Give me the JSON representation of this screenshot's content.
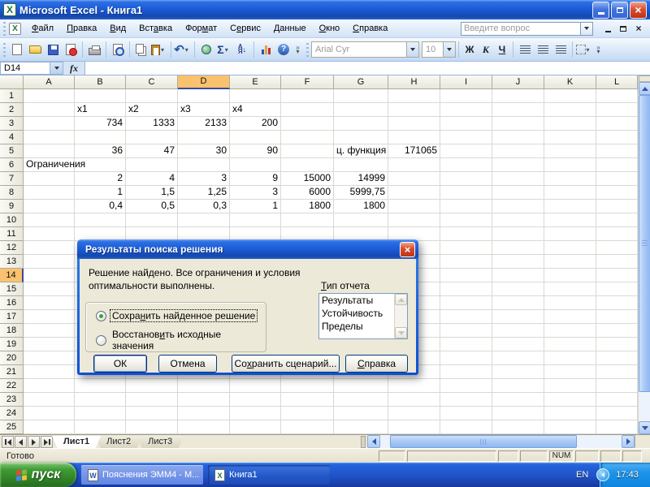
{
  "window": {
    "title": "Microsoft Excel - Книга1"
  },
  "icons": {
    "excel_letter": "X",
    "word_letter": "W",
    "close": "×",
    "dropdown": "▾",
    "chevron": "»",
    "sigma": "Σ",
    "undo": "↶",
    "help": "?",
    "sort_a": "А",
    "sort_z": "Я",
    "sort_arrow": "↓",
    "fx": "fx"
  },
  "menu": {
    "question_placeholder": "Введите вопрос",
    "items": [
      {
        "name": "file",
        "label": "Файл",
        "u": 0
      },
      {
        "name": "edit",
        "label": "Правка",
        "u": 0
      },
      {
        "name": "view",
        "label": "Вид",
        "u": 0
      },
      {
        "name": "insert",
        "label": "Вставка",
        "u": 3
      },
      {
        "name": "format",
        "label": "Формат",
        "u": 3
      },
      {
        "name": "tools",
        "label": "Сервис",
        "u": 1
      },
      {
        "name": "data",
        "label": "Данные",
        "u": 0
      },
      {
        "name": "window",
        "label": "Окно",
        "u": 0
      },
      {
        "name": "help",
        "label": "Справка",
        "u": 0
      }
    ]
  },
  "toolbar": {
    "font_name": "Arial Cyr",
    "font_size": "10",
    "bold": "Ж",
    "italic": "К",
    "underline": "Ч"
  },
  "formula_bar": {
    "name_box": "D14"
  },
  "sheet": {
    "columns": [
      "A",
      "B",
      "C",
      "D",
      "E",
      "F",
      "G",
      "H",
      "I",
      "J",
      "K",
      "L"
    ],
    "selected_column": "D",
    "selected_row": 14,
    "row_count": 25,
    "cells": [
      {
        "r": 2,
        "c": "B",
        "v": "x1",
        "a": "l"
      },
      {
        "r": 2,
        "c": "C",
        "v": "x2",
        "a": "l"
      },
      {
        "r": 2,
        "c": "D",
        "v": "x3",
        "a": "l"
      },
      {
        "r": 2,
        "c": "E",
        "v": "x4",
        "a": "l"
      },
      {
        "r": 3,
        "c": "B",
        "v": "734",
        "a": "r"
      },
      {
        "r": 3,
        "c": "C",
        "v": "1333",
        "a": "r"
      },
      {
        "r": 3,
        "c": "D",
        "v": "2133",
        "a": "r"
      },
      {
        "r": 3,
        "c": "E",
        "v": "200",
        "a": "r"
      },
      {
        "r": 5,
        "c": "B",
        "v": "36",
        "a": "r"
      },
      {
        "r": 5,
        "c": "C",
        "v": "47",
        "a": "r"
      },
      {
        "r": 5,
        "c": "D",
        "v": "30",
        "a": "r"
      },
      {
        "r": 5,
        "c": "E",
        "v": "90",
        "a": "r"
      },
      {
        "r": 5,
        "c": "G",
        "v": "ц. функция",
        "a": "l"
      },
      {
        "r": 5,
        "c": "H",
        "v": "171065",
        "a": "r"
      },
      {
        "r": 6,
        "c": "A",
        "v": "Ограничения",
        "a": "l"
      },
      {
        "r": 7,
        "c": "B",
        "v": "2",
        "a": "r"
      },
      {
        "r": 7,
        "c": "C",
        "v": "4",
        "a": "r"
      },
      {
        "r": 7,
        "c": "D",
        "v": "3",
        "a": "r"
      },
      {
        "r": 7,
        "c": "E",
        "v": "9",
        "a": "r"
      },
      {
        "r": 7,
        "c": "F",
        "v": "15000",
        "a": "r"
      },
      {
        "r": 7,
        "c": "G",
        "v": "14999",
        "a": "r"
      },
      {
        "r": 8,
        "c": "B",
        "v": "1",
        "a": "r"
      },
      {
        "r": 8,
        "c": "C",
        "v": "1,5",
        "a": "r"
      },
      {
        "r": 8,
        "c": "D",
        "v": "1,25",
        "a": "r"
      },
      {
        "r": 8,
        "c": "E",
        "v": "3",
        "a": "r"
      },
      {
        "r": 8,
        "c": "F",
        "v": "6000",
        "a": "r"
      },
      {
        "r": 8,
        "c": "G",
        "v": "5999,75",
        "a": "r"
      },
      {
        "r": 9,
        "c": "B",
        "v": "0,4",
        "a": "r"
      },
      {
        "r": 9,
        "c": "C",
        "v": "0,5",
        "a": "r"
      },
      {
        "r": 9,
        "c": "D",
        "v": "0,3",
        "a": "r"
      },
      {
        "r": 9,
        "c": "E",
        "v": "1",
        "a": "r"
      },
      {
        "r": 9,
        "c": "F",
        "v": "1800",
        "a": "r"
      },
      {
        "r": 9,
        "c": "G",
        "v": "1800",
        "a": "r"
      }
    ]
  },
  "dialog": {
    "title": "Результаты поиска решения",
    "message": "Решение найдено. Все ограничения и условия оптимальности выполнены.",
    "report_label": {
      "label": "Тип отчета",
      "u": 0
    },
    "report_items": [
      "Результаты",
      "Устойчивость",
      "Пределы"
    ],
    "radios": [
      {
        "name": "save-solution",
        "label": "Сохранить найденное решение",
        "u": 5,
        "selected": true
      },
      {
        "name": "restore-values",
        "label": "Восстановить исходные значения",
        "u": 9,
        "selected": false
      }
    ],
    "buttons": [
      {
        "name": "ok",
        "label": "ОК",
        "default": true
      },
      {
        "name": "cancel",
        "label": "Отмена"
      },
      {
        "name": "save-scenario",
        "label": "Сохранить сценарий...",
        "u": 2
      },
      {
        "name": "help",
        "label": "Справка",
        "u": 0
      }
    ]
  },
  "tabs": {
    "sheets": [
      {
        "name": "sheet1",
        "label": "Лист1",
        "active": true
      },
      {
        "name": "sheet2",
        "label": "Лист2",
        "active": false
      },
      {
        "name": "sheet3",
        "label": "Лист3",
        "active": false
      }
    ]
  },
  "status": {
    "ready": "Готово",
    "panels": [
      "",
      "",
      "",
      "",
      "NUM",
      "",
      "",
      ""
    ]
  },
  "taskbar": {
    "start_label": "пуск",
    "tasks": [
      {
        "name": "word-document-task",
        "app": "word",
        "label": "Пояснения ЭММ4 - M...",
        "active": false
      },
      {
        "name": "excel-workbook-task",
        "app": "excel",
        "label": "Книга1",
        "active": true
      }
    ],
    "lang": "EN",
    "time": "17:43"
  }
}
